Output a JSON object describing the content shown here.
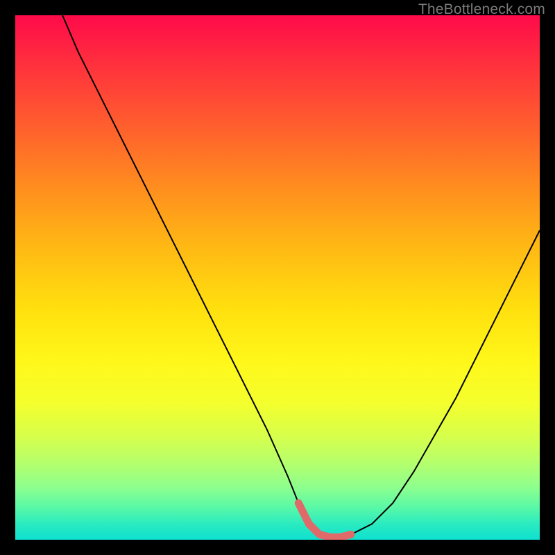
{
  "watermark": "TheBottleneck.com",
  "colors": {
    "frame": "#000000",
    "curve": "#000000",
    "flat_segment": "#e06a6a",
    "gradient_top": "#ff0a4a",
    "gradient_mid": "#ffe00e",
    "gradient_bottom": "#0fe0d0"
  },
  "chart_data": {
    "type": "line",
    "title": "",
    "xlabel": "",
    "ylabel": "",
    "xlim": [
      0,
      100
    ],
    "ylim": [
      0,
      100
    ],
    "x": [
      9,
      12,
      16,
      20,
      24,
      28,
      32,
      36,
      40,
      44,
      48,
      52,
      54,
      56,
      58,
      60,
      62,
      64,
      68,
      72,
      76,
      80,
      84,
      88,
      92,
      96,
      100
    ],
    "values": [
      100,
      93,
      85,
      77,
      69,
      61,
      53,
      45,
      37,
      29,
      21,
      12,
      7,
      3,
      1,
      0.5,
      0.5,
      1,
      3,
      7,
      13,
      20,
      27,
      35,
      43,
      51,
      59
    ],
    "flat_segment": {
      "x_start": 54,
      "x_end": 64,
      "y": 1
    },
    "annotations": []
  }
}
